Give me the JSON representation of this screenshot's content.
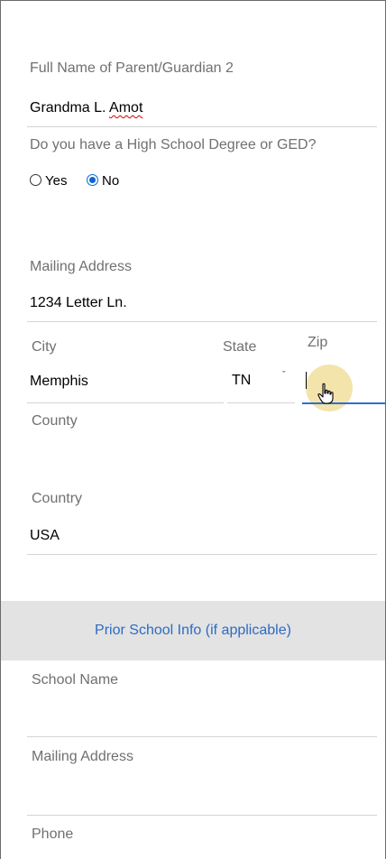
{
  "parent2": {
    "label": "Full Name of Parent/Guardian 2",
    "value_first": "Grandma L. ",
    "value_misspelled": "Amot"
  },
  "diploma": {
    "question": "Do you have a High School Degree or GED?",
    "options": [
      "Yes",
      "No"
    ],
    "selected": "No"
  },
  "mailing": {
    "label": "Mailing Address",
    "value": "1234 Letter Ln."
  },
  "city": {
    "label": "City",
    "value": "Memphis"
  },
  "state": {
    "label": "State",
    "value": "TN"
  },
  "zip": {
    "label": "Zip",
    "value": ""
  },
  "county": {
    "label": "County",
    "value": ""
  },
  "country": {
    "label": "Country",
    "value": "USA"
  },
  "prior_school": {
    "header": "Prior School Info (if applicable)",
    "school_name_label": "School Name",
    "mailing_label": "Mailing Address",
    "phone_label": "Phone"
  },
  "colors": {
    "accent": "#2e6bc2",
    "radio": "#0a66d8",
    "section_bg": "#e3e3e3",
    "label": "#707070"
  },
  "icons": {
    "state_dropdown": "chevron-down-icon",
    "pointer": "hand-pointer-icon"
  }
}
